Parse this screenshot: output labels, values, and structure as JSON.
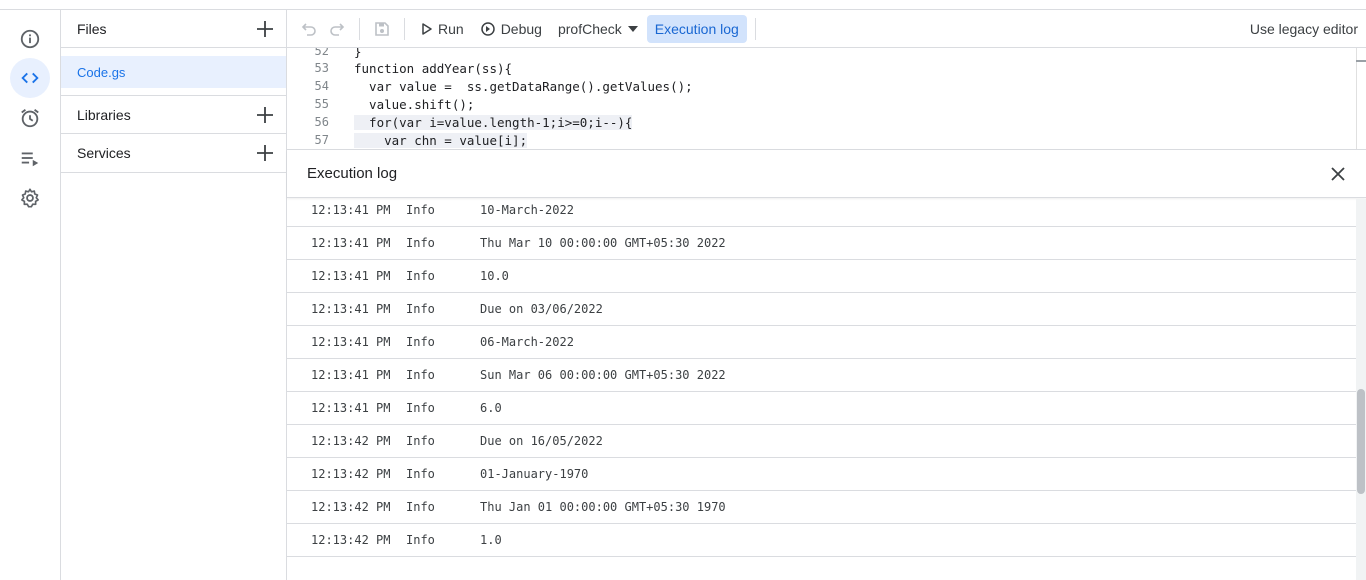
{
  "rail": {
    "items": [
      {
        "name": "overview",
        "icon": "info-icon"
      },
      {
        "name": "editor",
        "icon": "code-icon",
        "active": true
      },
      {
        "name": "triggers",
        "icon": "alarm-clock-icon"
      },
      {
        "name": "executions",
        "icon": "executions-list-icon"
      },
      {
        "name": "settings",
        "icon": "gear-icon"
      }
    ]
  },
  "files_panel": {
    "title": "Files",
    "file": "Code.gs",
    "libraries": "Libraries",
    "services": "Services"
  },
  "toolbar": {
    "run_label": "Run",
    "debug_label": "Debug",
    "function_select": "profCheck",
    "log_label": "Execution log",
    "legacy_label": "Use legacy editor"
  },
  "editor": {
    "lines": [
      {
        "n": "52",
        "code": "}"
      },
      {
        "n": "53",
        "code": "function addYear(ss){"
      },
      {
        "n": "54",
        "code": "  var value =  ss.getDataRange().getValues();"
      },
      {
        "n": "55",
        "code": "  value.shift();"
      },
      {
        "n": "56",
        "code": "  for(var i=value.length-1;i>=0;i--){"
      },
      {
        "n": "57",
        "code": "    var chn = value[i];"
      }
    ]
  },
  "log": {
    "title": "Execution log",
    "rows": [
      {
        "time": "12:13:41 PM",
        "level": "Info",
        "message": "10-March-2022"
      },
      {
        "time": "12:13:41 PM",
        "level": "Info",
        "message": "Thu Mar 10 00:00:00 GMT+05:30 2022"
      },
      {
        "time": "12:13:41 PM",
        "level": "Info",
        "message": "10.0"
      },
      {
        "time": "12:13:41 PM",
        "level": "Info",
        "message": "Due on 03/06/2022"
      },
      {
        "time": "12:13:41 PM",
        "level": "Info",
        "message": "06-March-2022"
      },
      {
        "time": "12:13:41 PM",
        "level": "Info",
        "message": "Sun Mar 06 00:00:00 GMT+05:30 2022"
      },
      {
        "time": "12:13:41 PM",
        "level": "Info",
        "message": "6.0"
      },
      {
        "time": "12:13:42 PM",
        "level": "Info",
        "message": "Due on 16/05/2022"
      },
      {
        "time": "12:13:42 PM",
        "level": "Info",
        "message": "01-January-1970"
      },
      {
        "time": "12:13:42 PM",
        "level": "Info",
        "message": "Thu Jan 01 00:00:00 GMT+05:30 1970"
      },
      {
        "time": "12:13:42 PM",
        "level": "Info",
        "message": "1.0"
      }
    ]
  },
  "colors": {
    "accent": "#1a73e8",
    "active_bg": "#e8f0fe",
    "button_active_bg": "#d2e3fc"
  }
}
